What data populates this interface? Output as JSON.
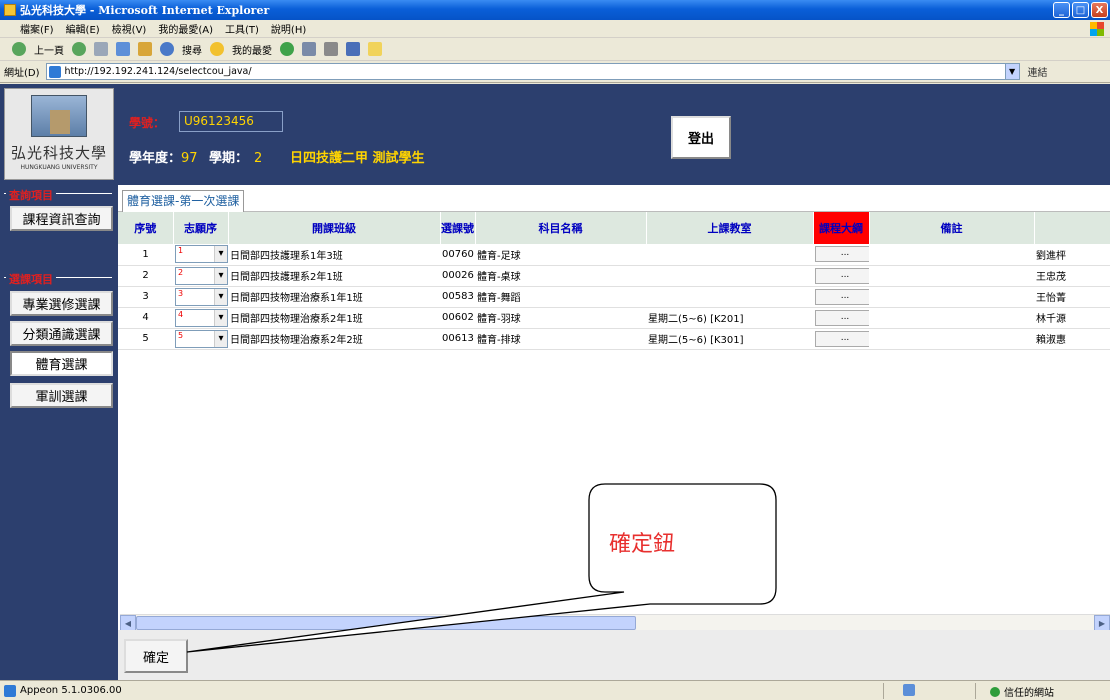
{
  "window": {
    "title": "弘光科技大學 - Microsoft Internet Explorer",
    "minimize": "_",
    "maximize": "□",
    "close": "X"
  },
  "menu": [
    "檔案(F)",
    "編輯(E)",
    "檢視(V)",
    "我的最愛(A)",
    "工具(T)",
    "說明(H)"
  ],
  "toolbar": {
    "back": "上一頁",
    "search": "搜尋",
    "favorites": "我的最愛"
  },
  "address": {
    "label": "網址(D)",
    "url": "http://192.192.241.124/selectcou_java/",
    "links": "連結"
  },
  "header": {
    "logo_name": "弘光科技大學",
    "logo_en": "HUNGKUANG UNIVERSITY",
    "student_id_label": "學號：",
    "student_id": "U96123456",
    "year_label": "學年度：",
    "year": "97",
    "term_label": "學期：",
    "term": "2",
    "class_info": "日四技護二甲 測試學生",
    "logout": "登出"
  },
  "sidebar": {
    "query_section": "查詢項目",
    "query_items": [
      "課程資訊查詢"
    ],
    "select_section": "選課項目",
    "select_items": [
      "專業選修選課",
      "分類通識選課",
      "體育選課",
      "軍訓選課"
    ]
  },
  "tab": {
    "label": "體育選課-第一次選課"
  },
  "grid": {
    "headers": {
      "seq": "序號",
      "pref": "志願序",
      "class": "開課班級",
      "code": "選課號",
      "subject": "科目名稱",
      "room": "上課教室",
      "outline": "課程大綱",
      "note": "備註"
    },
    "rows": [
      {
        "seq": "1",
        "pref": "1",
        "class": "日間部四技護理系1年3班",
        "code": "00760",
        "subject": "體育-足球",
        "room": "",
        "outline": "...",
        "note": "",
        "teacher": "劉進枰"
      },
      {
        "seq": "2",
        "pref": "2",
        "class": "日間部四技護理系2年1班",
        "code": "00026",
        "subject": "體育-桌球",
        "room": "",
        "outline": "...",
        "note": "",
        "teacher": "王忠茂"
      },
      {
        "seq": "3",
        "pref": "3",
        "class": "日間部四技物理治療系1年1班",
        "code": "00583",
        "subject": "體育-舞蹈",
        "room": "",
        "outline": "...",
        "note": "",
        "teacher": "王怡菁"
      },
      {
        "seq": "4",
        "pref": "4",
        "class": "日間部四技物理治療系2年1班",
        "code": "00602",
        "subject": "體育-羽球",
        "room": "星期二(5~6) [K201]",
        "outline": "...",
        "note": "",
        "teacher": "林千源"
      },
      {
        "seq": "5",
        "pref": "5",
        "class": "日間部四技物理治療系2年2班",
        "code": "00613",
        "subject": "體育-排球",
        "room": "星期二(5~6) [K301]",
        "outline": "...",
        "note": "",
        "teacher": "賴淑惠"
      }
    ]
  },
  "confirm": "確定",
  "callout": "確定鈕",
  "status": {
    "left": "Appeon 5.1.0306.00",
    "zone": "信任的網站"
  },
  "colors": {
    "header_bg": "#2c3f6e",
    "accent_yellow": "#ffd400",
    "accent_red": "#e02020",
    "grid_header_bg": "#dde8df",
    "callout_text": "#e8302f"
  }
}
